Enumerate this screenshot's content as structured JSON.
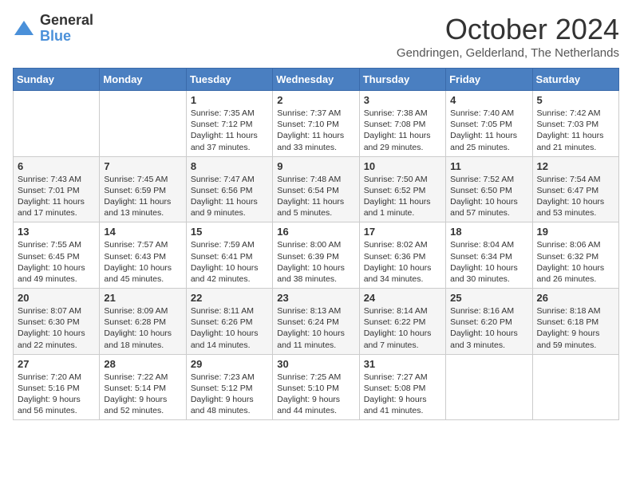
{
  "header": {
    "logo_general": "General",
    "logo_blue": "Blue",
    "month_title": "October 2024",
    "subtitle": "Gendringen, Gelderland, The Netherlands"
  },
  "days_of_week": [
    "Sunday",
    "Monday",
    "Tuesday",
    "Wednesday",
    "Thursday",
    "Friday",
    "Saturday"
  ],
  "weeks": [
    [
      {
        "day": "",
        "info": ""
      },
      {
        "day": "",
        "info": ""
      },
      {
        "day": "1",
        "info": "Sunrise: 7:35 AM\nSunset: 7:12 PM\nDaylight: 11 hours and 37 minutes."
      },
      {
        "day": "2",
        "info": "Sunrise: 7:37 AM\nSunset: 7:10 PM\nDaylight: 11 hours and 33 minutes."
      },
      {
        "day": "3",
        "info": "Sunrise: 7:38 AM\nSunset: 7:08 PM\nDaylight: 11 hours and 29 minutes."
      },
      {
        "day": "4",
        "info": "Sunrise: 7:40 AM\nSunset: 7:05 PM\nDaylight: 11 hours and 25 minutes."
      },
      {
        "day": "5",
        "info": "Sunrise: 7:42 AM\nSunset: 7:03 PM\nDaylight: 11 hours and 21 minutes."
      }
    ],
    [
      {
        "day": "6",
        "info": "Sunrise: 7:43 AM\nSunset: 7:01 PM\nDaylight: 11 hours and 17 minutes."
      },
      {
        "day": "7",
        "info": "Sunrise: 7:45 AM\nSunset: 6:59 PM\nDaylight: 11 hours and 13 minutes."
      },
      {
        "day": "8",
        "info": "Sunrise: 7:47 AM\nSunset: 6:56 PM\nDaylight: 11 hours and 9 minutes."
      },
      {
        "day": "9",
        "info": "Sunrise: 7:48 AM\nSunset: 6:54 PM\nDaylight: 11 hours and 5 minutes."
      },
      {
        "day": "10",
        "info": "Sunrise: 7:50 AM\nSunset: 6:52 PM\nDaylight: 11 hours and 1 minute."
      },
      {
        "day": "11",
        "info": "Sunrise: 7:52 AM\nSunset: 6:50 PM\nDaylight: 10 hours and 57 minutes."
      },
      {
        "day": "12",
        "info": "Sunrise: 7:54 AM\nSunset: 6:47 PM\nDaylight: 10 hours and 53 minutes."
      }
    ],
    [
      {
        "day": "13",
        "info": "Sunrise: 7:55 AM\nSunset: 6:45 PM\nDaylight: 10 hours and 49 minutes."
      },
      {
        "day": "14",
        "info": "Sunrise: 7:57 AM\nSunset: 6:43 PM\nDaylight: 10 hours and 45 minutes."
      },
      {
        "day": "15",
        "info": "Sunrise: 7:59 AM\nSunset: 6:41 PM\nDaylight: 10 hours and 42 minutes."
      },
      {
        "day": "16",
        "info": "Sunrise: 8:00 AM\nSunset: 6:39 PM\nDaylight: 10 hours and 38 minutes."
      },
      {
        "day": "17",
        "info": "Sunrise: 8:02 AM\nSunset: 6:36 PM\nDaylight: 10 hours and 34 minutes."
      },
      {
        "day": "18",
        "info": "Sunrise: 8:04 AM\nSunset: 6:34 PM\nDaylight: 10 hours and 30 minutes."
      },
      {
        "day": "19",
        "info": "Sunrise: 8:06 AM\nSunset: 6:32 PM\nDaylight: 10 hours and 26 minutes."
      }
    ],
    [
      {
        "day": "20",
        "info": "Sunrise: 8:07 AM\nSunset: 6:30 PM\nDaylight: 10 hours and 22 minutes."
      },
      {
        "day": "21",
        "info": "Sunrise: 8:09 AM\nSunset: 6:28 PM\nDaylight: 10 hours and 18 minutes."
      },
      {
        "day": "22",
        "info": "Sunrise: 8:11 AM\nSunset: 6:26 PM\nDaylight: 10 hours and 14 minutes."
      },
      {
        "day": "23",
        "info": "Sunrise: 8:13 AM\nSunset: 6:24 PM\nDaylight: 10 hours and 11 minutes."
      },
      {
        "day": "24",
        "info": "Sunrise: 8:14 AM\nSunset: 6:22 PM\nDaylight: 10 hours and 7 minutes."
      },
      {
        "day": "25",
        "info": "Sunrise: 8:16 AM\nSunset: 6:20 PM\nDaylight: 10 hours and 3 minutes."
      },
      {
        "day": "26",
        "info": "Sunrise: 8:18 AM\nSunset: 6:18 PM\nDaylight: 9 hours and 59 minutes."
      }
    ],
    [
      {
        "day": "27",
        "info": "Sunrise: 7:20 AM\nSunset: 5:16 PM\nDaylight: 9 hours and 56 minutes."
      },
      {
        "day": "28",
        "info": "Sunrise: 7:22 AM\nSunset: 5:14 PM\nDaylight: 9 hours and 52 minutes."
      },
      {
        "day": "29",
        "info": "Sunrise: 7:23 AM\nSunset: 5:12 PM\nDaylight: 9 hours and 48 minutes."
      },
      {
        "day": "30",
        "info": "Sunrise: 7:25 AM\nSunset: 5:10 PM\nDaylight: 9 hours and 44 minutes."
      },
      {
        "day": "31",
        "info": "Sunrise: 7:27 AM\nSunset: 5:08 PM\nDaylight: 9 hours and 41 minutes."
      },
      {
        "day": "",
        "info": ""
      },
      {
        "day": "",
        "info": ""
      }
    ]
  ]
}
